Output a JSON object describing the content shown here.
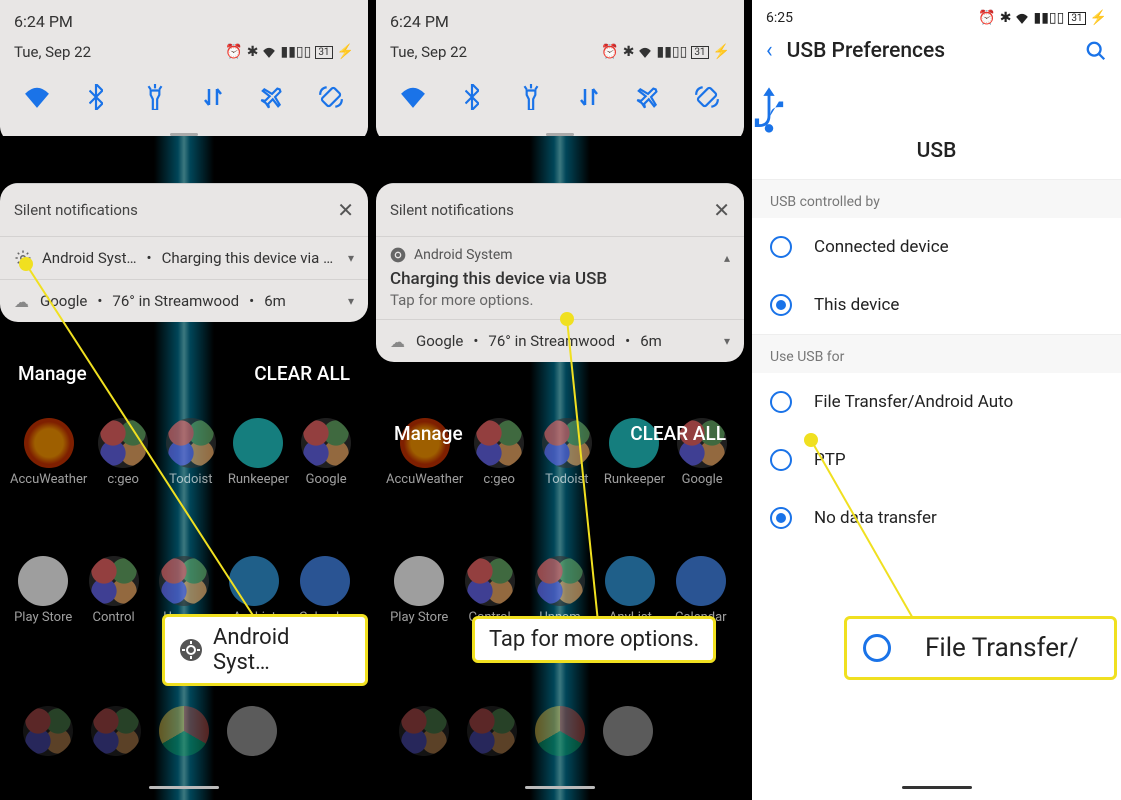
{
  "screen1": {
    "time": "6:24 PM",
    "date": "Tue, Sep 22",
    "battery": "31",
    "silent_header": "Silent notifications",
    "notif_app": "Android Syst…",
    "notif_text": "Charging this device via USB",
    "weather_src": "Google",
    "weather_text": "76° in Streamwood",
    "weather_time": "6m",
    "manage": "Manage",
    "clear_all": "CLEAR ALL",
    "apps_row1": [
      "AccuWeather",
      "c:geo",
      "Todoist",
      "Runkeeper",
      "Google"
    ],
    "apps_row2": [
      "Play Store",
      "Control",
      "Unnam",
      "AnyList",
      "Calendar"
    ],
    "callout": "Android Syst…"
  },
  "screen2": {
    "time": "6:24 PM",
    "date": "Tue, Sep 22",
    "battery": "31",
    "silent_header": "Silent notifications",
    "notif_app": "Android System",
    "notif_title": "Charging this device via USB",
    "notif_sub": "Tap for more options.",
    "weather_src": "Google",
    "weather_text": "76° in Streamwood",
    "weather_time": "6m",
    "manage": "Manage",
    "clear_all": "CLEAR ALL",
    "apps_row1": [
      "AccuWeather",
      "c:geo",
      "Todoist",
      "Runkeeper",
      "Google"
    ],
    "apps_row2": [
      "Play Store",
      "Control",
      "Unnam",
      "AnyList",
      "Calendar"
    ],
    "callout": "Tap for more options."
  },
  "screen3": {
    "time": "6:25",
    "battery": "31",
    "title": "USB Preferences",
    "hero": "USB",
    "section1": "USB controlled by",
    "opt_connected": "Connected device",
    "opt_this": "This device",
    "section2": "Use USB for",
    "opt_file": "File Transfer/Android Auto",
    "opt_ptp": "PTP",
    "opt_nodata": "No data transfer",
    "callout": "File Transfer/"
  }
}
